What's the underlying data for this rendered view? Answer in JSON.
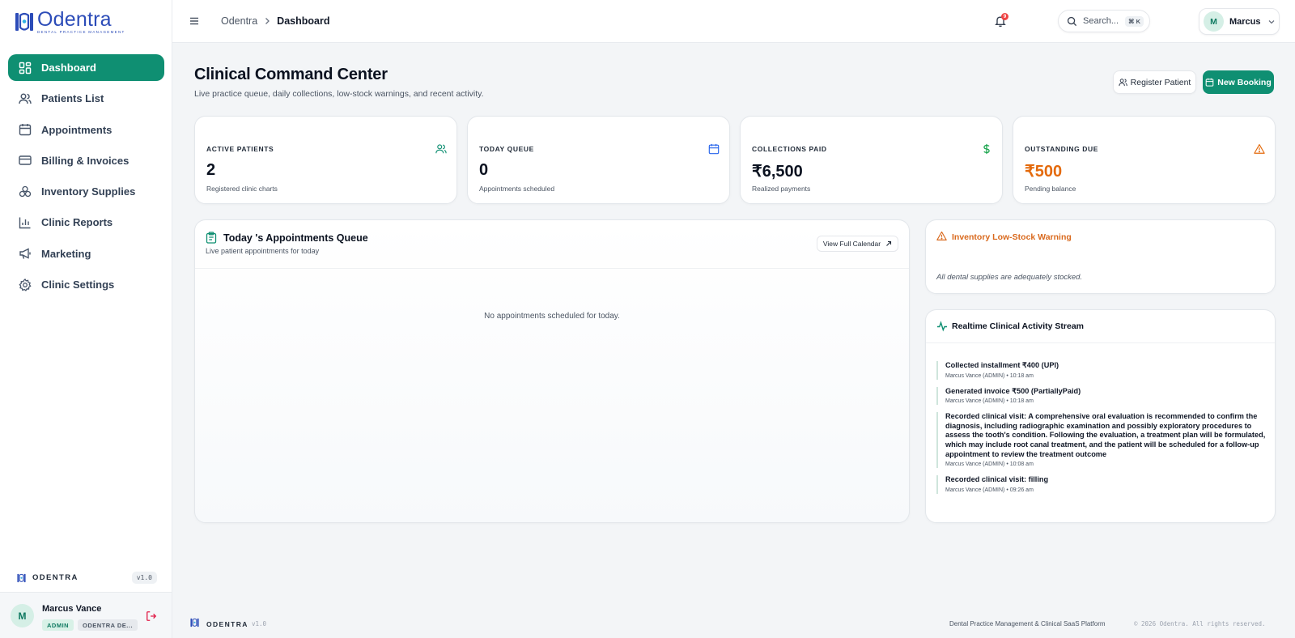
{
  "brand": {
    "name": "Odentra",
    "tagline": "DENTAL PRACTICE MANAGEMENT",
    "short": "ODENTRA",
    "version": "v1.0",
    "accent": "#0f8f72",
    "logo_color": "#2c4cb8"
  },
  "sidebar": {
    "items": [
      {
        "label": "Dashboard",
        "icon": "dashboard-icon",
        "active": true
      },
      {
        "label": "Patients List",
        "icon": "users-icon"
      },
      {
        "label": "Appointments",
        "icon": "calendar-icon"
      },
      {
        "label": "Billing & Invoices",
        "icon": "credit-card-icon"
      },
      {
        "label": "Inventory Supplies",
        "icon": "supplies-icon"
      },
      {
        "label": "Clinic Reports",
        "icon": "bar-chart-icon"
      },
      {
        "label": "Marketing",
        "icon": "megaphone-icon"
      },
      {
        "label": "Clinic Settings",
        "icon": "gear-icon"
      }
    ]
  },
  "user": {
    "initial": "M",
    "full_name": "Marcus Vance",
    "first_name": "Marcus",
    "role": "ADMIN",
    "org": "ODENTRA DE..."
  },
  "header": {
    "breadcrumb_root": "Odentra",
    "breadcrumb_current": "Dashboard",
    "search_placeholder": "Search...",
    "search_shortcut": "⌘ K",
    "notification_count": "9"
  },
  "page": {
    "title": "Clinical Command Center",
    "subtitle": "Live practice queue, daily collections, low-stock warnings, and recent activity.",
    "register_label": "Register Patient",
    "booking_label": "New Booking"
  },
  "stats": [
    {
      "label": "ACTIVE PATIENTS",
      "value": "2",
      "hint": "Registered clinic charts",
      "icon": "users-icon",
      "color": "#0f8f72"
    },
    {
      "label": "TODAY QUEUE",
      "value": "0",
      "hint": "Appointments scheduled",
      "icon": "calendar-icon",
      "color": "#2563eb"
    },
    {
      "label": "COLLECTIONS PAID",
      "value": "₹6,500",
      "hint": "Realized payments",
      "icon": "dollar-icon",
      "color": "#16a34a"
    },
    {
      "label": "OUTSTANDING DUE",
      "value": "₹500",
      "hint": "Pending balance",
      "icon": "warning-icon",
      "color": "#e46a0c"
    }
  ],
  "queue": {
    "title": "Today 's Appointments Queue",
    "subtitle": "Live patient appointments for today",
    "calendar_label": "View Full Calendar",
    "empty": "No appointments scheduled for today."
  },
  "inventory": {
    "title": "Inventory Low-Stock Warning",
    "message": "All dental supplies are adequately stocked."
  },
  "activity": {
    "title": "Realtime Clinical Activity Stream",
    "items": [
      {
        "text": "Collected installment ₹400 (UPI)",
        "meta": "Marcus Vance (ADMIN) • 10:18 am"
      },
      {
        "text": "Generated invoice ₹500 (PartiallyPaid)",
        "meta": "Marcus Vance (ADMIN) • 10:18 am"
      },
      {
        "text": "Recorded clinical visit: A comprehensive oral evaluation is recommended to confirm the diagnosis, including radiographic examination and possibly exploratory procedures to assess the tooth's condition. Following the evaluation, a treatment plan will be formulated, which may include root canal treatment, and the patient will be scheduled for a follow-up appointment to review the treatment outcome",
        "meta": "Marcus Vance (ADMIN) • 10:08 am"
      },
      {
        "text": "Recorded clinical visit: filling",
        "meta": "Marcus Vance (ADMIN) • 09:26 am"
      }
    ]
  },
  "footer": {
    "tagline": "Dental Practice Management & Clinical SaaS Platform",
    "copyright": "© 2026 Odentra. All rights reserved."
  }
}
